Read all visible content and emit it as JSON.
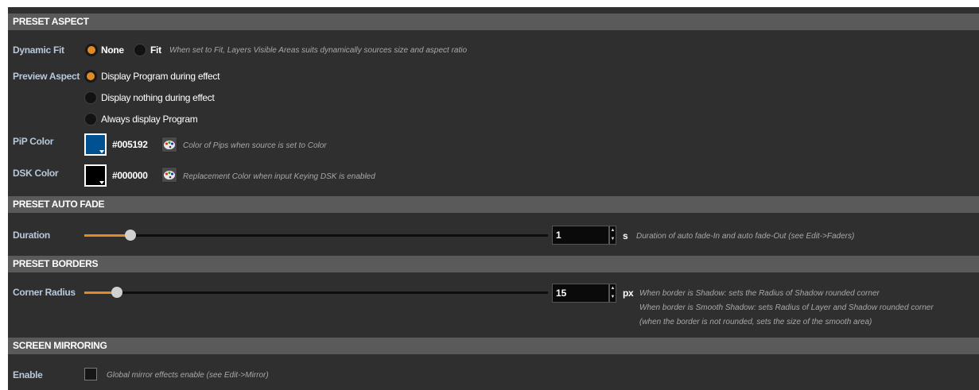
{
  "preset_aspect": {
    "header": "PRESET ASPECT",
    "dynamic_fit": {
      "label": "Dynamic Fit",
      "options": [
        "None",
        "Fit"
      ],
      "selected": "None",
      "hint": "When set to Fit, Layers Visible Areas suits dynamically sources size and aspect ratio"
    },
    "preview_aspect": {
      "label": "Preview Aspect",
      "options": [
        "Display Program during effect",
        "Display nothing during effect",
        "Always display Program"
      ],
      "selected": "Display Program during effect"
    },
    "pip_color": {
      "label": "PiP Color",
      "value": "#005192",
      "color": "#005192",
      "hint": "Color of Pips when source is set to Color",
      "icon": "palette-icon"
    },
    "dsk_color": {
      "label": "DSK Color",
      "value": "#000000",
      "color": "#000000",
      "hint": "Replacement Color when input Keying DSK is enabled",
      "icon": "palette-icon"
    }
  },
  "preset_auto_fade": {
    "header": "PRESET AUTO FADE",
    "duration": {
      "label": "Duration",
      "value": "1",
      "unit": "s",
      "slider_fraction": 0.1,
      "hint": "Duration of auto fade-In and auto fade-Out (see Edit->Faders)"
    }
  },
  "preset_borders": {
    "header": "PRESET BORDERS",
    "corner_radius": {
      "label": "Corner Radius",
      "value": "15",
      "unit": "px",
      "slider_fraction": 0.07,
      "hint_lines": [
        "When border is Shadow: sets the Radius of Shadow rounded corner",
        "When border is Smooth Shadow: sets Radius of Layer and Shadow rounded corner",
        "(when the border is not rounded, sets the size of the smooth area)"
      ]
    }
  },
  "screen_mirroring": {
    "header": "SCREEN MIRRORING",
    "enable": {
      "label": "Enable",
      "checked": false,
      "hint": "Global mirror effects enable (see Edit->Mirror)"
    }
  },
  "colors": {
    "accent": "#e08a25",
    "panel_bg": "#2f2f2f",
    "header_bg": "#5a5a5a"
  }
}
